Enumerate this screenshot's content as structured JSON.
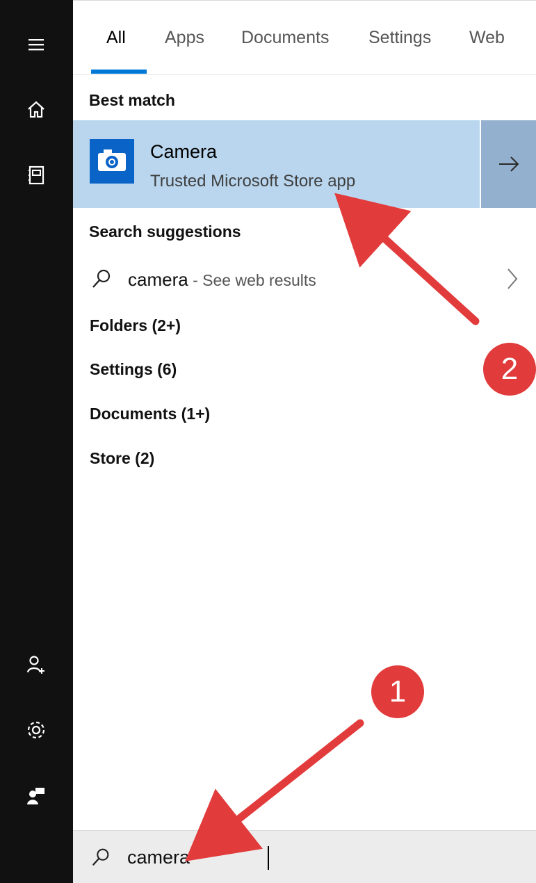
{
  "tabs": [
    {
      "label": "All",
      "active": true
    },
    {
      "label": "Apps",
      "active": false
    },
    {
      "label": "Documents",
      "active": false
    },
    {
      "label": "Settings",
      "active": false
    },
    {
      "label": "Web",
      "active": false
    }
  ],
  "best_match": {
    "heading": "Best match",
    "app_name": "Camera",
    "app_subtitle": "Trusted Microsoft Store app",
    "icon": "camera-icon",
    "open_arrow_icon": "arrow-right-icon"
  },
  "search_suggestions": {
    "heading": "Search suggestions",
    "items": [
      {
        "term": "camera",
        "separator": " - ",
        "hint": "See web results",
        "icon": "search-icon",
        "chevron_icon": "chevron-right-icon"
      }
    ]
  },
  "categories": [
    {
      "label": "Folders (2+)"
    },
    {
      "label": "Settings (6)"
    },
    {
      "label": "Documents (1+)"
    },
    {
      "label": "Store (2)"
    }
  ],
  "rail": {
    "top": [
      {
        "icon": "hamburger-menu-icon"
      },
      {
        "icon": "home-icon"
      },
      {
        "icon": "notebook-icon"
      }
    ],
    "bottom": [
      {
        "icon": "add-user-icon"
      },
      {
        "icon": "settings-gear-icon"
      },
      {
        "icon": "feedback-icon"
      }
    ]
  },
  "search": {
    "value": "camera",
    "icon": "search-icon"
  },
  "annotations": [
    {
      "label": "1"
    },
    {
      "label": "2"
    }
  ],
  "colors": {
    "accent": "#0078d7",
    "highlight": "#b9d6ee",
    "highlight_button": "#93b1cf",
    "rail_bg": "#111111",
    "annotation_red": "#e23b3b"
  }
}
